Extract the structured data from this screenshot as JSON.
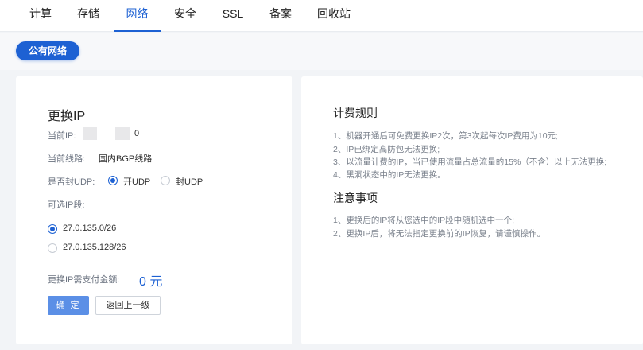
{
  "tabs": [
    {
      "label": "计算"
    },
    {
      "label": "存储"
    },
    {
      "label": "网络",
      "active": true
    },
    {
      "label": "安全"
    },
    {
      "label": "SSL"
    },
    {
      "label": "备案"
    },
    {
      "label": "回收站"
    }
  ],
  "subtab": {
    "label": "公有网络"
  },
  "change_ip": {
    "title": "更换IP",
    "current_ip_label": "当前IP:",
    "current_ip_suffix": "0",
    "line_label": "当前线路:",
    "line_value": "国内BGP线路",
    "udp_label": "是否封UDP:",
    "udp_options": [
      "开UDP",
      "封UDP"
    ],
    "udp_selected": "开UDP",
    "ip_segment_label": "可选IP段:",
    "ip_segments": [
      "27.0.135.0/26",
      "27.0.135.128/26"
    ],
    "ip_segment_selected": "27.0.135.0/26",
    "pay_label": "更换IP需支付金额:",
    "pay_amount": "0 元",
    "confirm_label": "确 定",
    "back_label": "返回上一级"
  },
  "billing": {
    "title": "计费规则",
    "rules": [
      "1、机器开通后可免费更换IP2次，第3次起每次IP费用为10元;",
      "2、IP已绑定高防包无法更换;",
      "3、以流量计费的IP，当已使用流量占总流量的15%（不含）以上无法更换;",
      "4、黑洞状态中的IP无法更换。"
    ]
  },
  "notes": {
    "title": "注意事项",
    "items": [
      "1、更换后的IP将从您选中的IP段中随机选中一个;",
      "2、更换IP后，将无法指定更换前的IP恢复，请谨慎操作。"
    ]
  },
  "colors": {
    "accent": "#1d61d3",
    "button_primary": "#5b8fe6"
  }
}
